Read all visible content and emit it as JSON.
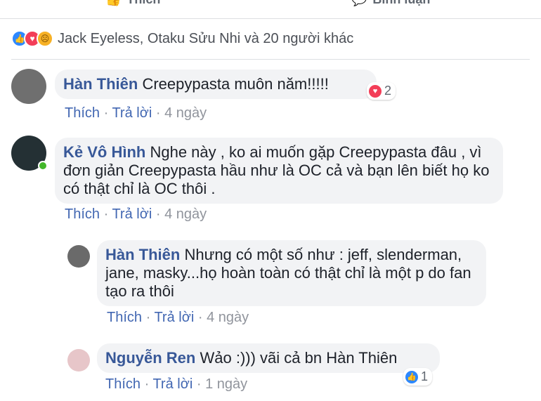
{
  "top_actions": {
    "like_label": "Thích",
    "comment_label": "Bình luận"
  },
  "reactions": {
    "summary": "Jack Eyeless, Otaku Sửu Nhi và 20 người khác"
  },
  "comments": [
    {
      "author": "Hàn Thiên",
      "text": "Creepypasta muôn năm!!!!!",
      "reaction_count": "2",
      "actions": {
        "like": "Thích",
        "reply": "Trả lời",
        "time": "4 ngày"
      }
    },
    {
      "author": "Kẻ Vô Hình",
      "text": "Nghe này , ko ai muốn gặp Creepypasta đâu , vì đơn giản Creepypasta hầu như là OC cả và bạn lên biết họ ko có thật chỉ là OC thôi .",
      "actions": {
        "like": "Thích",
        "reply": "Trả lời",
        "time": "4 ngày"
      },
      "replies": [
        {
          "author": "Hàn Thiên",
          "text": "Nhưng có một số như : jeff, slenderman, jane, masky...họ hoàn toàn có thật chỉ là một p do fan tạo ra thôi",
          "actions": {
            "like": "Thích",
            "reply": "Trả lời",
            "time": "4 ngày"
          }
        },
        {
          "author": "Nguyễn Ren",
          "text": "Wảo :))) vãi cả bn Hàn Thiên",
          "reaction_count": "1",
          "actions": {
            "like": "Thích",
            "reply": "Trả lời",
            "time": "1 ngày"
          }
        }
      ]
    }
  ]
}
